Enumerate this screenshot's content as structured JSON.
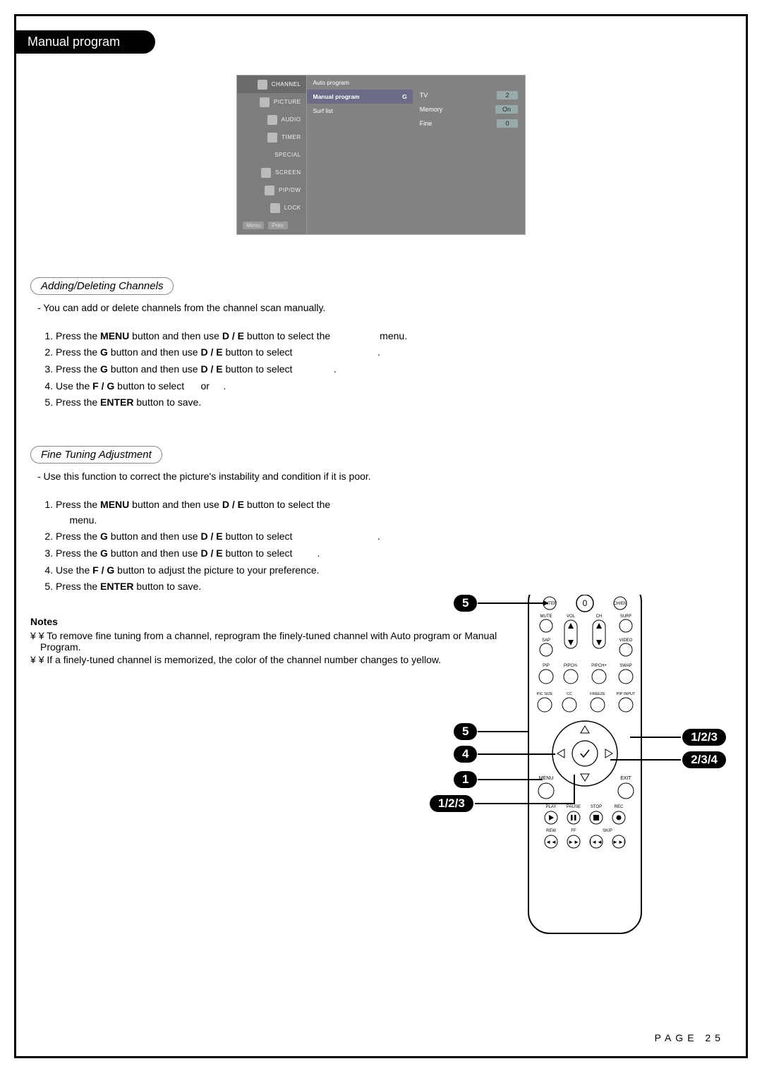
{
  "title": "Manual program",
  "osd": {
    "left": [
      "CHANNEL",
      "PICTURE",
      "AUDIO",
      "TIMER",
      "SPECIAL",
      "SCREEN",
      "PIP/DW",
      "LOCK"
    ],
    "mid": {
      "auto": "Auto program",
      "manual": "Manual program",
      "manual_arrow": "G",
      "surf": "Surf list"
    },
    "right_rows": [
      {
        "k": "TV",
        "v": "2"
      },
      {
        "k": "Memory",
        "v": "On"
      },
      {
        "k": "Fine",
        "v": "0"
      }
    ],
    "menu_btn": "Menu",
    "prev_btn": "Prev."
  },
  "sec1": {
    "head": "Adding/Deleting Channels",
    "intro": "- You can add or delete channels from the channel scan manually.",
    "steps": [
      {
        "pre": "Press the ",
        "b": "MENU",
        "mid": " button and then use ",
        "sym": "D / E",
        "post": " button to select the ",
        "tail": " menu."
      },
      {
        "pre": "Press the ",
        "b": "G",
        "mid": " button and then use ",
        "sym": "D / E",
        "post": " button to select ",
        "tail": "."
      },
      {
        "pre": "Press the ",
        "b": "G",
        "mid": " button and then use ",
        "sym": "D / E",
        "post": " button to select ",
        "tail": "."
      },
      {
        "pre": "Use the ",
        "b": "F / G",
        "mid": " button to select ",
        "post": " or ",
        "tail": "."
      },
      {
        "pre": "Press the ",
        "b": "ENTER",
        "mid": " button to save.",
        "tail": ""
      }
    ]
  },
  "sec2": {
    "head": "Fine Tuning Adjustment",
    "intro": "- Use this function to correct the picture's instability and condition if it is poor.",
    "steps": [
      {
        "pre": "Press the ",
        "b": "MENU",
        "mid": " button and then use ",
        "sym": "D / E",
        "post": " button to select the ",
        "tail": " menu."
      },
      {
        "pre": "Press the ",
        "b": "G",
        "mid": " button and then use ",
        "sym": "D / E",
        "post": " button to select ",
        "tail": "."
      },
      {
        "pre": "Press the ",
        "b": "G",
        "mid": " button and then use ",
        "sym": "D / E",
        "post": " button to select ",
        "tail": "."
      },
      {
        "pre": "Use the ",
        "b": "F / G",
        "mid": " button to adjust the picture to your preference.",
        "tail": ""
      },
      {
        "pre": "Press the ",
        "b": "ENTER",
        "mid": " button to save.",
        "tail": ""
      }
    ]
  },
  "notes": {
    "head": "Notes",
    "items": [
      "To remove fine tuning from a channel, reprogram the finely-tuned channel with Auto program or Manual Program.",
      "If a finely-tuned channel is memorized, the color of the channel number changes to yellow."
    ]
  },
  "remote_labels": {
    "row1": [
      "ENTER",
      "0",
      "CH/EN"
    ],
    "row2": [
      "MUTE",
      "VOL",
      "CH",
      "SURF"
    ],
    "row3": [
      "SAP",
      "VIDEO"
    ],
    "row4": [
      "PIP",
      "PIPCH-",
      "PIPCH+",
      "SWAP"
    ],
    "row5": [
      "PIC SIZE",
      "CC",
      "FREEZE",
      "PIP INPUT"
    ],
    "nav": [
      "MENU",
      "EXIT"
    ],
    "play": [
      "PLAY",
      "PAUSE",
      "STOP",
      "REC"
    ],
    "rew": [
      "REW",
      "FF",
      "SKIP"
    ]
  },
  "callouts": {
    "c1": "5",
    "c2": "5",
    "c3": "4",
    "c4": "1",
    "c5": "1/2/3",
    "c6": "1/2/3",
    "c7": "2/3/4"
  },
  "page": "PAGE 25"
}
